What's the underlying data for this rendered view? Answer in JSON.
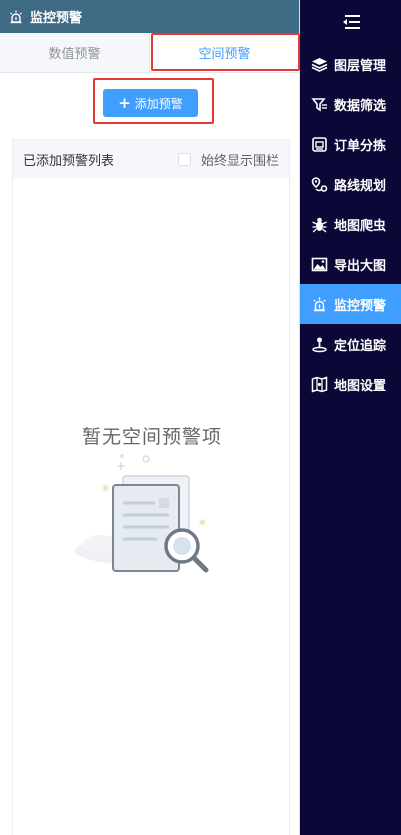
{
  "panel": {
    "title": "监控预警",
    "title_icon": "alarm-icon",
    "tabs": [
      {
        "label": "数值预警",
        "active": false
      },
      {
        "label": "空间预警",
        "active": true
      }
    ],
    "add_button": {
      "label": "添加预警",
      "icon": "plus-icon"
    },
    "list": {
      "title": "已添加预警列表",
      "option_label": "始终显示围栏",
      "option_checked": false,
      "empty_text": "暂无空间预警项"
    }
  },
  "nav": {
    "toggle_icon": "menu-collapse-icon",
    "items": [
      {
        "label": "图层管理",
        "icon": "layers-icon",
        "active": false
      },
      {
        "label": "数据筛选",
        "icon": "filter-icon",
        "active": false
      },
      {
        "label": "订单分拣",
        "icon": "sort-icon",
        "active": false
      },
      {
        "label": "路线规划",
        "icon": "route-icon",
        "active": false
      },
      {
        "label": "地图爬虫",
        "icon": "spider-icon",
        "active": false
      },
      {
        "label": "导出大图",
        "icon": "image-export-icon",
        "active": false
      },
      {
        "label": "监控预警",
        "icon": "alarm-icon",
        "active": true
      },
      {
        "label": "定位追踪",
        "icon": "locate-icon",
        "active": false
      },
      {
        "label": "地图设置",
        "icon": "map-settings-icon",
        "active": false
      }
    ]
  },
  "colors": {
    "header_bg": "#3f6a84",
    "nav_bg": "#0b0838",
    "accent": "#409eff",
    "highlight": "#e53935"
  }
}
